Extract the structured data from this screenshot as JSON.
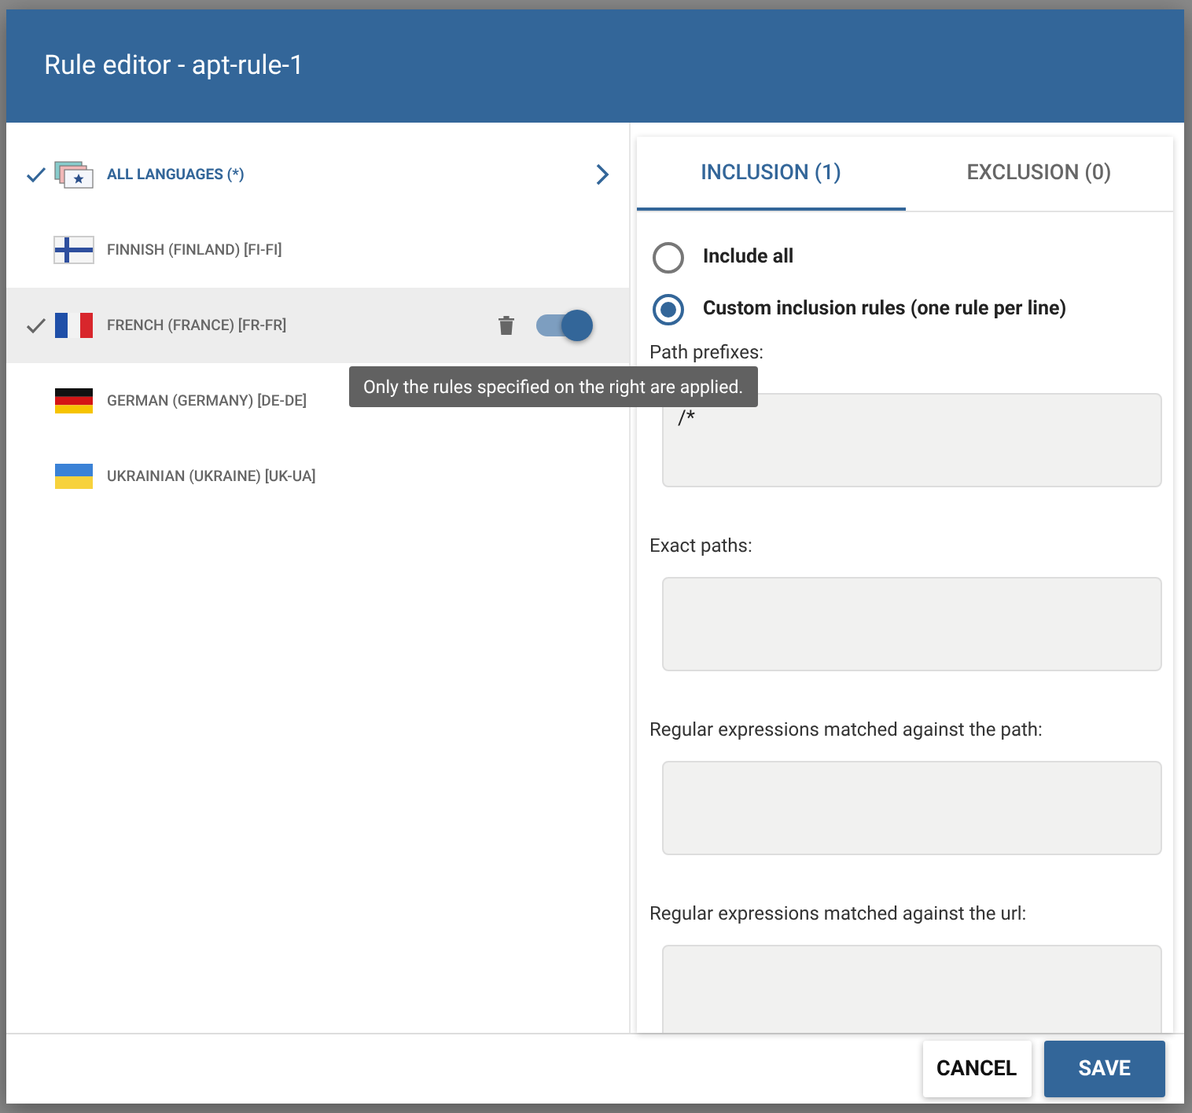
{
  "window": {
    "title": "Rule editor - apt-rule-1"
  },
  "languages": [
    {
      "kind": "all",
      "label": "ALL LANGUAGES (*)",
      "checked": true,
      "selected": false
    },
    {
      "kind": "fi",
      "label": "FINNISH (FINLAND) [FI-FI]",
      "checked": false,
      "selected": false
    },
    {
      "kind": "fr",
      "label": "FRENCH (FRANCE) [FR-FR]",
      "checked": true,
      "selected": true,
      "toggle_on": true,
      "tooltip": "Only the rules specified on the right are applied."
    },
    {
      "kind": "de",
      "label": "GERMAN (GERMANY) [DE-DE]",
      "checked": false,
      "selected": false
    },
    {
      "kind": "ua",
      "label": "UKRAINIAN (UKRAINE) [UK-UA]",
      "checked": false,
      "selected": false
    }
  ],
  "tabs": [
    {
      "label": "INCLUSION (1)",
      "selected": true
    },
    {
      "label": "EXCLUSION (0)",
      "selected": false
    }
  ],
  "radios": [
    {
      "label": "Include all",
      "selected": false
    },
    {
      "label": "Custom inclusion rules (one rule per line)",
      "selected": true
    }
  ],
  "fields": [
    {
      "label": "Path prefixes:",
      "value": "/*"
    },
    {
      "label": "Exact paths:"
    },
    {
      "label": "Regular expressions matched against the path:"
    },
    {
      "label": "Regular expressions matched against the url:"
    }
  ],
  "buttons": [
    {
      "kind": "secondary",
      "label": "CANCEL"
    },
    {
      "kind": "primary",
      "label": "SAVE"
    }
  ]
}
